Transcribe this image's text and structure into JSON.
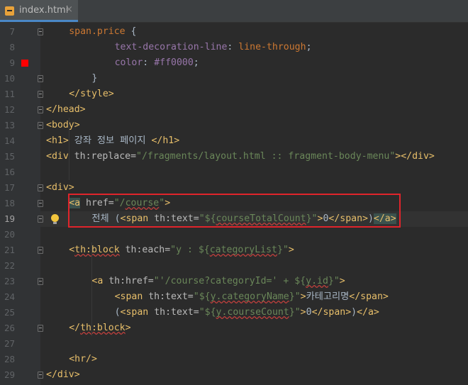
{
  "tab": {
    "filename": "index.html",
    "close_glyph": "×",
    "icon": "html-file-icon"
  },
  "colors": {
    "background": "#2b2b2b",
    "gutter": "#313335",
    "tag": "#e8bf6a",
    "attr": "#bababa",
    "string": "#6a8759",
    "keyword": "#cc7832",
    "highlight_box": "#e0242b",
    "breakpoint": "#ff0000"
  },
  "lines": [
    {
      "num": "7",
      "t": [
        [
          "k",
          "span.price "
        ],
        [
          "x",
          "{"
        ]
      ]
    },
    {
      "num": "8",
      "t": [
        [
          "p",
          "text-decoration-line"
        ],
        [
          "x",
          ": "
        ],
        [
          "k",
          "line-through"
        ],
        [
          "x",
          ";"
        ]
      ]
    },
    {
      "num": "9",
      "t": [
        [
          "p",
          "color"
        ],
        [
          "x",
          ": "
        ],
        [
          "p",
          "#ff0000"
        ],
        [
          "x",
          ";"
        ]
      ]
    },
    {
      "num": "10",
      "t": [
        [
          "x",
          "}"
        ]
      ]
    },
    {
      "num": "11",
      "t": [
        [
          "t",
          "</style>"
        ]
      ]
    },
    {
      "num": "12",
      "t": [
        [
          "t",
          "</head>"
        ]
      ]
    },
    {
      "num": "13",
      "t": [
        [
          "t",
          "<body>"
        ]
      ]
    },
    {
      "num": "14",
      "t": [
        [
          "t",
          "<h1>"
        ],
        [
          "x",
          " 강좌 정보 페이지 "
        ],
        [
          "t",
          "</h1>"
        ]
      ]
    },
    {
      "num": "15",
      "t": [
        [
          "t",
          "<div "
        ],
        [
          "a",
          "th:replace="
        ],
        [
          "s",
          "\"/fragments/layout.html :: fragment-body-menu\""
        ],
        [
          "t",
          "></div>"
        ]
      ]
    },
    {
      "num": "16",
      "t": []
    },
    {
      "num": "17",
      "t": [
        [
          "t",
          "<div>"
        ]
      ]
    },
    {
      "num": "18",
      "t": [
        [
          "th",
          "<a"
        ],
        [
          "a",
          " href="
        ],
        [
          "s",
          "\"/"
        ],
        [
          "sw",
          "course"
        ],
        [
          "s",
          "\""
        ],
        [
          "t",
          ">"
        ]
      ]
    },
    {
      "num": "19",
      "t": [
        [
          "x",
          "전체 ("
        ],
        [
          "t",
          "<span "
        ],
        [
          "a",
          "th:text="
        ],
        [
          "s",
          "\"${"
        ],
        [
          "sw",
          "courseTotalCount"
        ],
        [
          "s",
          "}\""
        ],
        [
          "t",
          ">"
        ],
        [
          "x",
          "0"
        ],
        [
          "t",
          "</span>"
        ],
        [
          "x",
          ")"
        ],
        [
          "th",
          "</a>"
        ]
      ]
    },
    {
      "num": "20",
      "t": []
    },
    {
      "num": "21",
      "t": [
        [
          "t",
          "<"
        ],
        [
          "tw",
          "th:block"
        ],
        [
          "a",
          " th:each="
        ],
        [
          "s",
          "\"y : ${"
        ],
        [
          "sw",
          "categoryList"
        ],
        [
          "s",
          "}\""
        ],
        [
          "t",
          ">"
        ]
      ]
    },
    {
      "num": "22",
      "t": [
        [
          "caret",
          ""
        ]
      ]
    },
    {
      "num": "23",
      "t": [
        [
          "t",
          "<a "
        ],
        [
          "a",
          "th:href="
        ],
        [
          "s",
          "\"'/course?categoryId=' + ${"
        ],
        [
          "sw",
          "y.id"
        ],
        [
          "s",
          "}\""
        ],
        [
          "t",
          ">"
        ]
      ]
    },
    {
      "num": "24",
      "t": [
        [
          "t",
          "<span "
        ],
        [
          "a",
          "th:text="
        ],
        [
          "s",
          "\"${"
        ],
        [
          "sw",
          "y.categoryName"
        ],
        [
          "s",
          "}\""
        ],
        [
          "t",
          ">"
        ],
        [
          "x",
          "카테고리명"
        ],
        [
          "t",
          "</span>"
        ]
      ]
    },
    {
      "num": "25",
      "t": [
        [
          "x",
          "("
        ],
        [
          "t",
          "<span "
        ],
        [
          "a",
          "th:text="
        ],
        [
          "s",
          "\"${"
        ],
        [
          "sw",
          "y.courseCount"
        ],
        [
          "s",
          "}\""
        ],
        [
          "t",
          ">"
        ],
        [
          "x",
          "0"
        ],
        [
          "t",
          "</span>"
        ],
        [
          "x",
          ")"
        ],
        [
          "t",
          "</a>"
        ]
      ]
    },
    {
      "num": "26",
      "t": [
        [
          "t",
          "</"
        ],
        [
          "tw",
          "th:block"
        ],
        [
          "t",
          ">"
        ]
      ]
    },
    {
      "num": "27",
      "t": []
    },
    {
      "num": "28",
      "t": [
        [
          "t",
          "<hr/>"
        ]
      ]
    },
    {
      "num": "29",
      "t": [
        [
          "t",
          "</div>"
        ]
      ]
    }
  ]
}
